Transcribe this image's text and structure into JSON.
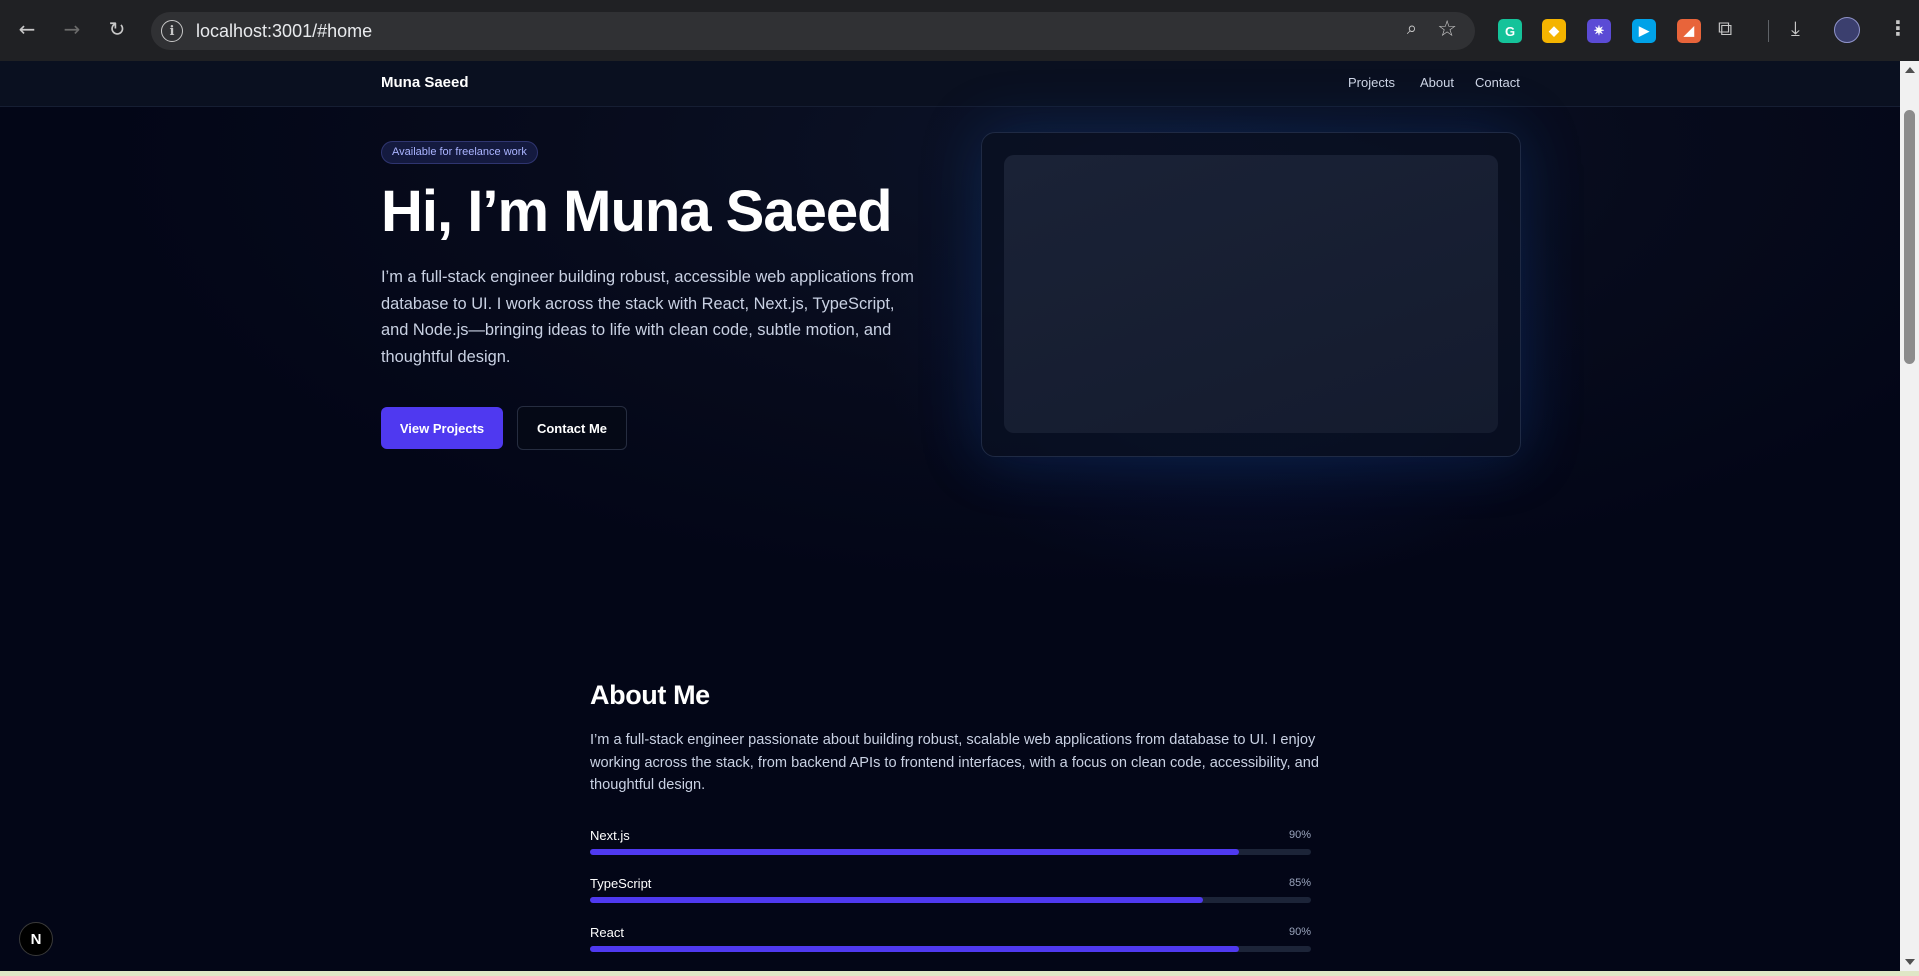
{
  "browser": {
    "url": "localhost:3001/#home",
    "extensions": [
      {
        "icon": "grammarly-icon",
        "glyph": "G",
        "color": "#15c39a"
      },
      {
        "icon": "diamond-extension-icon",
        "glyph": "◆",
        "color": "#f4b400"
      },
      {
        "icon": "gear-extension-icon",
        "glyph": "✷",
        "color": "#5b4bd5"
      },
      {
        "icon": "play-extension-icon",
        "glyph": "▶",
        "color": "#00a2e8"
      },
      {
        "icon": "flag-extension-icon",
        "glyph": "◢",
        "color": "#e8643a"
      }
    ]
  },
  "site": {
    "brand": "Muna Saeed",
    "nav": [
      "Projects",
      "About",
      "Contact"
    ]
  },
  "hero": {
    "badge": "Available for freelance work",
    "title": "Hi, I’m Muna Saeed",
    "text": "I’m a full-stack engineer building robust, accessible web applications from database to UI. I work across the stack with React, Next.js, TypeScript, and Node.js—bringing ideas to life with clean code, subtle motion, and thoughtful design.",
    "primary_cta": "View Projects",
    "secondary_cta": "Contact Me"
  },
  "about": {
    "title": "About Me",
    "text": "I’m a full-stack engineer passionate about building robust, scalable web applications from database to UI. I enjoy working across the stack, from backend APIs to frontend interfaces, with a focus on clean code, accessibility, and thoughtful design.",
    "skills": [
      {
        "name": "Next.js",
        "percent_label": "90%",
        "value": 0.9
      },
      {
        "name": "TypeScript",
        "percent_label": "85%",
        "value": 0.85
      },
      {
        "name": "React",
        "percent_label": "90%",
        "value": 0.9
      }
    ]
  },
  "colors": {
    "accent": "#4f39f0",
    "background": "#030617"
  },
  "dev_badge": "N"
}
